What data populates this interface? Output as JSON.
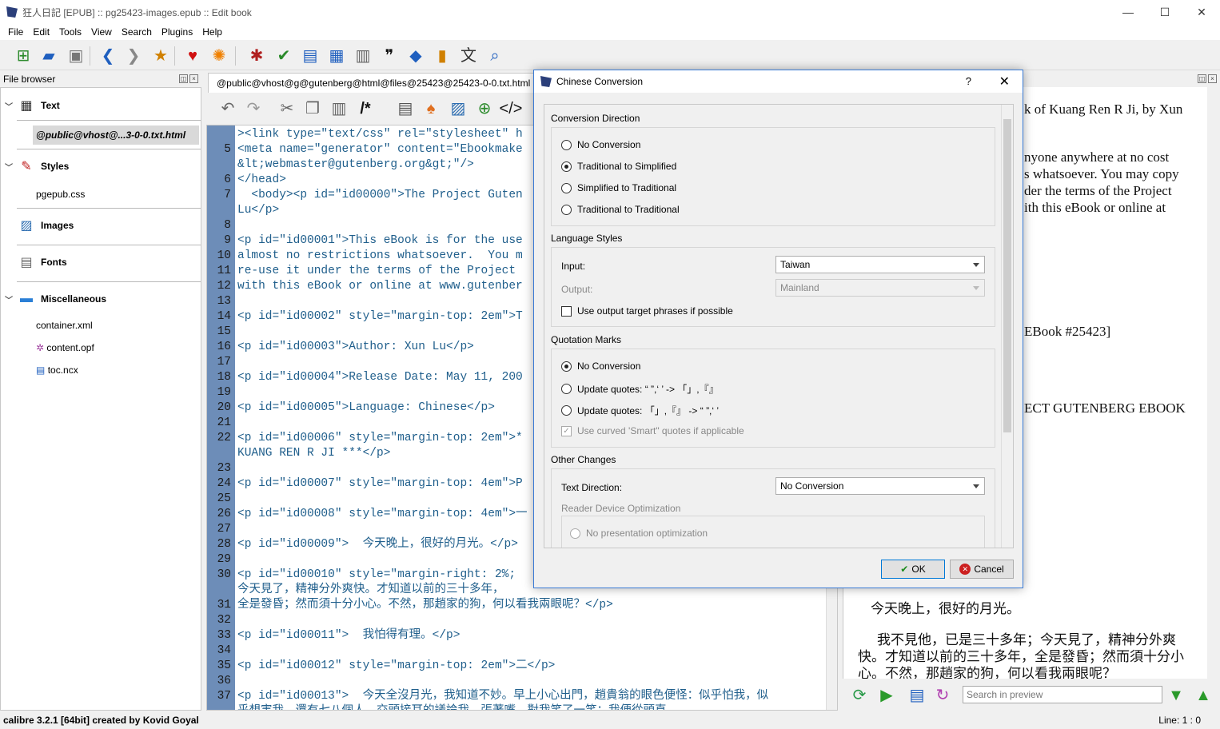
{
  "window": {
    "title": "狂人日記 [EPUB] :: pg25423-images.epub :: Edit book",
    "controls": {
      "minimize": "—",
      "maximize": "☐",
      "close": "✕"
    }
  },
  "menu": [
    "File",
    "Edit",
    "Tools",
    "View",
    "Search",
    "Plugins",
    "Help"
  ],
  "file_browser": {
    "title": "File browser",
    "sections": {
      "text": {
        "label": "Text",
        "files": [
          "@public@vhost@...3-0-0.txt.html"
        ]
      },
      "styles": {
        "label": "Styles",
        "files": [
          "pgepub.css"
        ]
      },
      "images": {
        "label": "Images"
      },
      "fonts": {
        "label": "Fonts"
      },
      "misc": {
        "label": "Miscellaneous",
        "files": [
          "container.xml",
          "content.opf",
          "toc.ncx"
        ]
      }
    }
  },
  "editor": {
    "tab_label": "@public@vhost@g@gutenberg@html@files@25423@25423-0-0.txt.html",
    "lines": [
      {
        "n": "",
        "t": "><link type=\"text/css\" rel=\"stylesheet\" h"
      },
      {
        "n": "5",
        "t": "<meta name=\"generator\" content=\"Ebookmake"
      },
      {
        "n": "",
        "t": "&lt;webmaster@gutenberg.org&gt;\"/>"
      },
      {
        "n": "6",
        "t": "</head>"
      },
      {
        "n": "7",
        "t": "  <body><p id=\"id00000\">The Project Guten"
      },
      {
        "n": "",
        "t": "Lu</p>"
      },
      {
        "n": "8",
        "t": ""
      },
      {
        "n": "9",
        "t": "<p id=\"id00001\">This eBook is for the use"
      },
      {
        "n": "10",
        "t": "almost no restrictions whatsoever.  You m"
      },
      {
        "n": "11",
        "t": "re-use it under the terms of the Project "
      },
      {
        "n": "12",
        "t": "with this eBook or online at www.gutenber"
      },
      {
        "n": "13",
        "t": ""
      },
      {
        "n": "14",
        "t": "<p id=\"id00002\" style=\"margin-top: 2em\">T"
      },
      {
        "n": "15",
        "t": ""
      },
      {
        "n": "16",
        "t": "<p id=\"id00003\">Author: Xun Lu</p>"
      },
      {
        "n": "17",
        "t": ""
      },
      {
        "n": "18",
        "t": "<p id=\"id00004\">Release Date: May 11, 200"
      },
      {
        "n": "19",
        "t": ""
      },
      {
        "n": "20",
        "t": "<p id=\"id00005\">Language: Chinese</p>"
      },
      {
        "n": "21",
        "t": ""
      },
      {
        "n": "22",
        "t": "<p id=\"id00006\" style=\"margin-top: 2em\">*"
      },
      {
        "n": "",
        "t": "KUANG REN R JI ***</p>"
      },
      {
        "n": "23",
        "t": ""
      },
      {
        "n": "24",
        "t": "<p id=\"id00007\" style=\"margin-top: 4em\">P"
      },
      {
        "n": "25",
        "t": ""
      },
      {
        "n": "26",
        "t": "<p id=\"id00008\" style=\"margin-top: 4em\">一"
      },
      {
        "n": "27",
        "t": ""
      },
      {
        "n": "28",
        "t": "<p id=\"id00009\">  今天晚上，很好的月光。</p>"
      },
      {
        "n": "29",
        "t": ""
      },
      {
        "n": "30",
        "t": "<p id=\"id00010\" style=\"margin-right: 2%;"
      },
      {
        "n": "",
        "t": "今天見了，精神分外爽快。才知道以前的三十多年，"
      },
      {
        "n": "31",
        "t": "全是發昏；然而須十分小心。不然，那趙家的狗，何以看我兩眼呢？</p>"
      },
      {
        "n": "32",
        "t": ""
      },
      {
        "n": "33",
        "t": "<p id=\"id00011\">  我怕得有理。</p>"
      },
      {
        "n": "34",
        "t": ""
      },
      {
        "n": "35",
        "t": "<p id=\"id00012\" style=\"margin-top: 2em\">二</p>"
      },
      {
        "n": "36",
        "t": ""
      },
      {
        "n": "37",
        "t": "<p id=\"id00013\">  今天全沒月光，我知道不妙。早上小心出門，趙貴翁的眼色便怪：似乎怕我，似"
      },
      {
        "n": "",
        "t": "乎想害我。還有七八個人，交頭接耳的議論我，張著嘴，對我笑了一笑；我便從頭直"
      }
    ]
  },
  "preview": {
    "lines": [
      "k of Kuang Ren R Ji, by Xun",
      "nyone anywhere at no cost",
      "s whatsoever. You may copy",
      "der the terms of the Project",
      "ith this eBook or online at",
      "EBook #25423]",
      "ECT GUTENBERG EBOOK",
      "今天晚上，很好的月光。",
      "我不見他，已是三十多年；今天見了，精神分外爽",
      "快。才知道以前的三十多年，全是發昏；然而須十分小",
      "心。不然，那趙家的狗，何以看我兩眼呢？"
    ],
    "search_placeholder": "Search in preview"
  },
  "status": {
    "left": "calibre 3.2.1 [64bit] created by Kovid Goyal",
    "right": "Line: 1 : 0"
  },
  "dialog": {
    "title": "Chinese Conversion",
    "help": "?",
    "close": "✕",
    "conversion_direction": {
      "label": "Conversion Direction",
      "options": [
        "No Conversion",
        "Traditional to Simplified",
        "Simplified to Traditional",
        "Traditional to Traditional"
      ],
      "selected": "Traditional to Simplified"
    },
    "language_styles": {
      "label": "Language Styles",
      "input_label": "Input:",
      "input_value": "Taiwan",
      "output_label": "Output:",
      "output_value": "Mainland",
      "use_output_phrases": "Use output target phrases if possible"
    },
    "quotation_marks": {
      "label": "Quotation Marks",
      "options": [
        "No Conversion",
        "Update quotes: “ ”,‘ ’ -> 「」,『』",
        "Update quotes: 「」,『』 -> “ ”,‘ ’"
      ],
      "selected": "No Conversion",
      "smart_quotes": "Use curved 'Smart\" quotes if applicable"
    },
    "other_changes": {
      "label": "Other Changes",
      "text_direction_label": "Text Direction:",
      "text_direction_value": "No Conversion",
      "reader_device_label": "Reader Device Optimization",
      "no_presentation": "No presentation optimization"
    },
    "ok": "OK",
    "cancel": "Cancel"
  },
  "colors": {
    "gutter": "#6d8db8",
    "highlight": "#ffdc7f",
    "tag": "#205f8c",
    "attr": "#2a7a2a",
    "accent": "#0078d7"
  }
}
